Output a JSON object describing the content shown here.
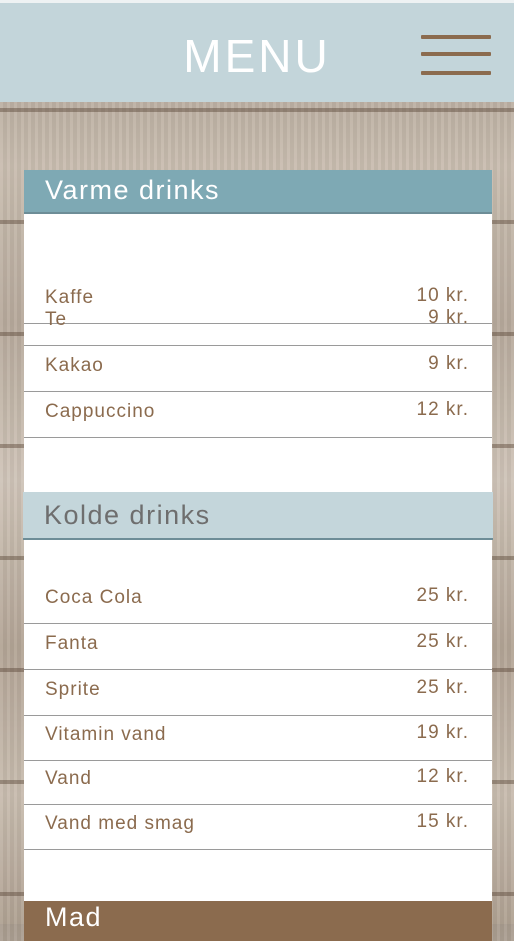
{
  "header": {
    "title": "MENU"
  },
  "sections": [
    {
      "title": "Varme drinks",
      "items": [
        {
          "name": "Kaffe",
          "price": "10 kr."
        },
        {
          "name": "Te",
          "price": "9 kr."
        },
        {
          "name": "Kakao",
          "price": "9 kr."
        },
        {
          "name": "Cappuccino",
          "price": "12 kr."
        }
      ]
    },
    {
      "title": "Kolde drinks",
      "items": [
        {
          "name": "Coca Cola",
          "price": "25 kr."
        },
        {
          "name": "Fanta",
          "price": "25 kr."
        },
        {
          "name": "Sprite",
          "price": "25 kr."
        },
        {
          "name": "Vitamin vand",
          "price": "19 kr."
        },
        {
          "name": "Vand",
          "price": "12 kr."
        },
        {
          "name": "Vand med smag",
          "price": "15 kr."
        }
      ]
    },
    {
      "title": "Mad",
      "items": []
    }
  ],
  "colors": {
    "header_bg": "#c3d5da",
    "section_warm_bg": "#7ea9b4",
    "section_cold_bg": "#c4d6db",
    "section_food_bg": "#8b6b4e",
    "item_text": "#8b6b4e"
  },
  "icons": {
    "menu": "hamburger-icon"
  }
}
